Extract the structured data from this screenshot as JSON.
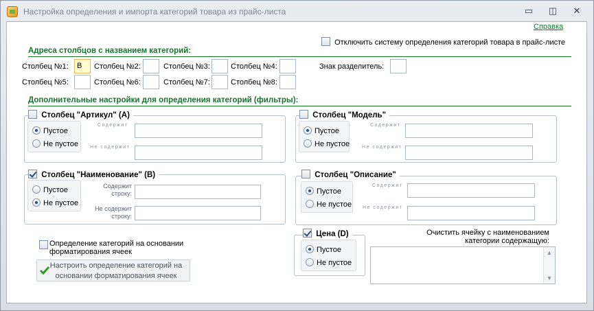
{
  "window": {
    "title": "Настройка определения и импорта категорий товара из прайс-листа",
    "controls": {
      "minimize": "▭",
      "restore": "◫",
      "close": "✕"
    }
  },
  "header": {
    "help_link": "Справка",
    "disable_checkbox": {
      "label": "Отключить систему определения категорий товара в прайс-листе",
      "checked": false
    }
  },
  "address_section": {
    "title": "Адреса столбцов с названием категорий:",
    "columns": [
      {
        "label": "Столбец №1:",
        "value": "B"
      },
      {
        "label": "Столбец №2:",
        "value": ""
      },
      {
        "label": "Столбец №3:",
        "value": ""
      },
      {
        "label": "Столбец №4:",
        "value": ""
      },
      {
        "label": "Столбец №5:",
        "value": ""
      },
      {
        "label": "Столбец №6:",
        "value": ""
      },
      {
        "label": "Столбец №7:",
        "value": ""
      },
      {
        "label": "Столбец №8:",
        "value": ""
      }
    ],
    "separator": {
      "label": "Знак разделитель:",
      "value": ""
    }
  },
  "filters_section": {
    "title": "Дополнительные настройки для определения категорий (фильтры):",
    "article": {
      "title": "Столбец \"Артикул\" (А)",
      "checked": false,
      "options": [
        "Пустое",
        "Не пустое"
      ],
      "selected": "Пустое",
      "contains_label": "Содержит",
      "not_contains_label": "Не содержит"
    },
    "model": {
      "title": "Столбец \"Модель\"",
      "checked": false,
      "options": [
        "Пустое",
        "Не пустое"
      ],
      "selected": "Пустое",
      "contains_label": "Содержит",
      "not_contains_label": "Не содержит"
    },
    "name": {
      "title": "Столбец \"Наименование\" (В)",
      "checked": true,
      "options": [
        "Пустое",
        "Не пустое"
      ],
      "selected": "Не пустое",
      "contains_label": "Содержит строку:",
      "not_contains_label": "Не содержит строку:"
    },
    "description": {
      "title": "Столбец \"Описание\"",
      "checked": false,
      "options": [
        "Пустое",
        "Не пустое"
      ],
      "selected": "Пустое",
      "contains_label": "Содержит",
      "not_contains_label": "Не содержит"
    },
    "price": {
      "title": "Цена (D)",
      "checked": true,
      "options": [
        "Пустое",
        "Не пустое"
      ],
      "selected": "Пустое"
    }
  },
  "formatting": {
    "checkbox_label_line1": "Определение категорий на основании",
    "checkbox_label_line2": "форматирования ячеек",
    "checked": false,
    "button_label_line1": "Настроить определение категорий на",
    "button_label_line2": "основании форматирования ячеек"
  },
  "clear_cell": {
    "label_line1": "Очистить ячейку с наименованием",
    "label_line2": "категории содержащую:",
    "value": ""
  },
  "colors": {
    "section_title": "#14752e",
    "link": "#0a7a2c",
    "active_input": "#fffbd0"
  }
}
